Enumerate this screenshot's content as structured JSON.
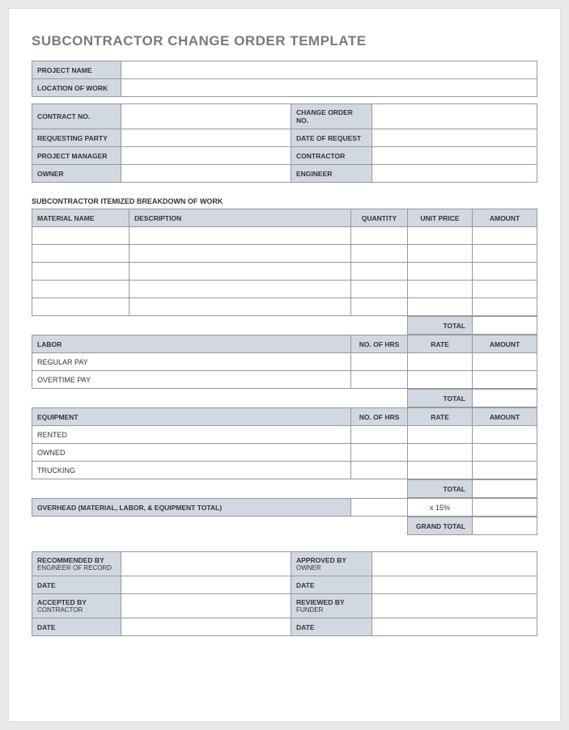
{
  "title": "SUBCONTRACTOR CHANGE ORDER TEMPLATE",
  "top": {
    "project_name": "PROJECT NAME",
    "location": "LOCATION OF WORK",
    "contract_no": "CONTRACT NO.",
    "change_order_no": "CHANGE ORDER NO.",
    "requesting_party": "REQUESTING PARTY",
    "date_of_request": "DATE OF REQUEST",
    "project_manager": "PROJECT MANAGER",
    "contractor": "CONTRACTOR",
    "owner": "OWNER",
    "engineer": "ENGINEER"
  },
  "breakdown_title": "SUBCONTRACTOR ITEMIZED BREAKDOWN OF WORK",
  "material": {
    "h_name": "MATERIAL NAME",
    "h_desc": "DESCRIPTION",
    "h_qty": "QUANTITY",
    "h_price": "UNIT PRICE",
    "h_amt": "AMOUNT"
  },
  "total": "TOTAL",
  "labor": {
    "h_labor": "LABOR",
    "h_hrs": "NO. OF HRS",
    "h_rate": "RATE",
    "h_amt": "AMOUNT",
    "row1": "REGULAR PAY",
    "row2": "OVERTIME PAY"
  },
  "equip": {
    "h_equip": "EQUIPMENT",
    "h_hrs": "NO. OF HRS",
    "h_rate": "RATE",
    "h_amt": "AMOUNT",
    "row1": "RENTED",
    "row2": "OWNED",
    "row3": "TRUCKING"
  },
  "overhead": {
    "label": "OVERHEAD (MATERIAL, LABOR, & EQUIPMENT TOTAL)",
    "pct": "x 15%"
  },
  "grand_total": "GRAND TOTAL",
  "sigs": {
    "recommended": "RECOMMENDED BY",
    "recommended_sub": "ENGINEER OF RECORD",
    "approved": "APPROVED BY",
    "approved_sub": "OWNER",
    "accepted": "ACCEPTED BY",
    "accepted_sub": "CONTRACTOR",
    "reviewed": "REVIEWED BY",
    "reviewed_sub": "FUNDER",
    "date": "DATE"
  }
}
